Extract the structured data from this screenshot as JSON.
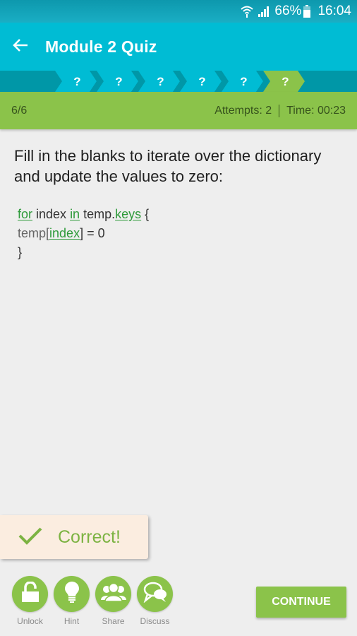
{
  "status_bar": {
    "wifi_icon": "wifi-icon",
    "signal_icon": "signal-icon",
    "battery": "66%",
    "battery_icon": "battery-icon",
    "time": "16:04"
  },
  "app_bar": {
    "back_icon": "arrow-left-icon",
    "title": "Module 2 Quiz"
  },
  "progress": {
    "steps": [
      {
        "label": "?",
        "state": "done"
      },
      {
        "label": "?",
        "state": "done"
      },
      {
        "label": "?",
        "state": "done"
      },
      {
        "label": "?",
        "state": "done"
      },
      {
        "label": "?",
        "state": "done"
      },
      {
        "label": "?",
        "state": "current"
      }
    ],
    "colors": {
      "track": "#0097a7",
      "step": "#00bcd4",
      "current": "#8bc34a"
    }
  },
  "info_bar": {
    "position": "6/6",
    "attempts": "Attempts: 2",
    "time": "Time: 00:23"
  },
  "question": {
    "text": "Fill in the blanks to iterate over the dictionary and update the values to zero:"
  },
  "code": {
    "line1": {
      "blank1": "for",
      "t1": " index ",
      "blank2": "in",
      "t2": " temp.",
      "blank3": "keys",
      "t3": " {"
    },
    "line2": {
      "t1": "temp[",
      "blank1": "index",
      "t2": "] = 0"
    },
    "line3": {
      "t1": "}"
    }
  },
  "toast": {
    "icon": "check-icon",
    "text": "Correct!"
  },
  "actions": [
    {
      "label": "Unlock",
      "icon": "unlock-icon"
    },
    {
      "label": "Hint",
      "icon": "lightbulb-icon"
    },
    {
      "label": "Share",
      "icon": "users-icon"
    },
    {
      "label": "Discuss",
      "icon": "chat-bubbles-icon"
    }
  ],
  "continue_label": "CONTINUE"
}
